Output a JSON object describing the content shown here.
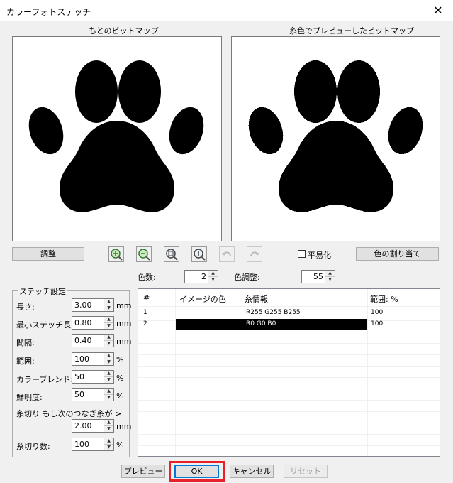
{
  "window": {
    "title": "カラーフォトステッチ",
    "close": "✕"
  },
  "panels": {
    "original_label": "もとのビットマップ",
    "preview_label": "糸色でプレビューしたビットマップ"
  },
  "toolbar": {
    "adjust_button": "調整",
    "icons": [
      "zoom-in-icon",
      "zoom-out-icon",
      "zoom-fit-icon",
      "zoom-actual-icon",
      "undo-icon",
      "redo-icon"
    ],
    "flatten_label": "平易化",
    "flatten_checked": false,
    "assign_colors_button": "色の割り当て"
  },
  "colors": {
    "count_label": "色数:",
    "count_value": "2",
    "adjust_label": "色調整:",
    "adjust_value": "55"
  },
  "stitch_settings": {
    "group_label": "ステッチ設定",
    "fields": [
      {
        "label": "長さ:",
        "value": "3.00",
        "unit": "mm"
      },
      {
        "label": "最小ステッチ長:",
        "value": "0.80",
        "unit": "mm"
      },
      {
        "label": "間隔:",
        "value": "0.40",
        "unit": "mm"
      },
      {
        "label": "範囲:",
        "value": "100",
        "unit": "%"
      },
      {
        "label": "カラーブレンド:",
        "value": "50",
        "unit": "%"
      },
      {
        "label": "鮮明度:",
        "value": "50",
        "unit": "%"
      }
    ],
    "trim_label": "糸切り もし次のつなぎ糸が >",
    "trim_value": "2.00",
    "trim_unit": "mm",
    "trim_count_label": "糸切り数:",
    "trim_count_value": "100",
    "trim_count_unit": "%"
  },
  "table": {
    "headers": [
      "#",
      "イメージの色",
      "糸情報",
      "範囲: %"
    ],
    "rows": [
      {
        "num": "1",
        "swatch": "#ffffff",
        "info": "R255 G255 B255",
        "range": "100"
      },
      {
        "num": "2",
        "swatch": "#000000",
        "info": "R0 G0 B0",
        "range": "100"
      }
    ]
  },
  "footer": {
    "preview_button": "プレビュー",
    "ok_button": "OK",
    "cancel_button": "キャンセル",
    "reset_button": "リセット"
  },
  "accent": {
    "highlight": "#e8202a",
    "focus": "#0078d7"
  }
}
